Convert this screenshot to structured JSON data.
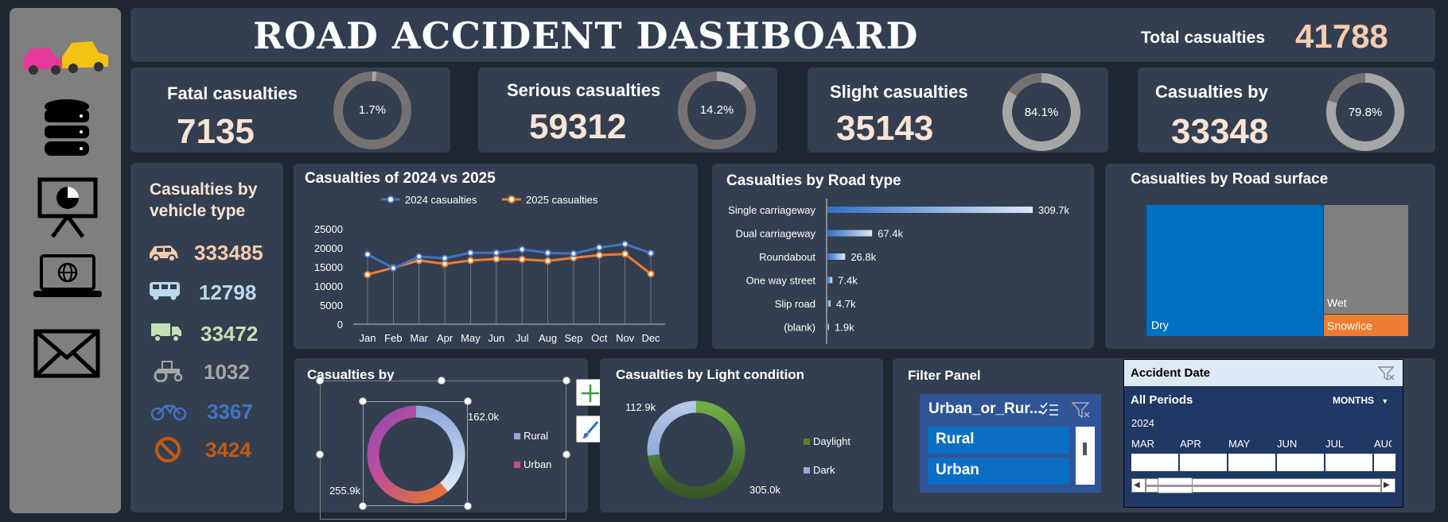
{
  "header": {
    "title": "ROAD ACCIDENT DASHBOARD",
    "total_label": "Total casualties",
    "total_value": "41788"
  },
  "kpis": [
    {
      "label": "Fatal casualties",
      "value": "7135",
      "pct": "1.7%",
      "fraction": 0.017
    },
    {
      "label": "Serious casualties",
      "value": "59312",
      "pct": "14.2%",
      "fraction": 0.142
    },
    {
      "label": "Slight casualties",
      "value": "35143",
      "pct": "84.1%",
      "fraction": 0.841
    },
    {
      "label": "Casualties by",
      "value": "33348",
      "pct": "79.8%",
      "fraction": 0.798
    }
  ],
  "vehicle": {
    "title_line1": "Casualties by",
    "title_line2": "vehicle type",
    "items": [
      {
        "icon": "car-icon",
        "value": "333485",
        "color": "#f8cbad"
      },
      {
        "icon": "bus-icon",
        "value": "12798",
        "color": "#bdd7ee"
      },
      {
        "icon": "truck-icon",
        "value": "33472",
        "color": "#c5e0b4"
      },
      {
        "icon": "tractor-icon",
        "value": "1032",
        "color": "#a6a6a6"
      },
      {
        "icon": "motorcycle-icon",
        "value": "3367",
        "color": "#4472c4"
      },
      {
        "icon": "no-entry-icon",
        "value": "3424",
        "color": "#c55a11"
      }
    ]
  },
  "charts": {
    "line": {
      "title": "Casualties of 2024 vs 2025",
      "chart_data": {
        "type": "line",
        "x": [
          "Jan",
          "Feb",
          "Mar",
          "Apr",
          "May",
          "Jun",
          "Jul",
          "Aug",
          "Sep",
          "Oct",
          "Nov",
          "Dec"
        ],
        "series": [
          {
            "name": "2024 casualties",
            "color": "#4472c4",
            "values": [
              18300,
              14700,
              17700,
              17300,
              18700,
              18700,
              19600,
              18700,
              18500,
              20100,
              21000,
              18600
            ]
          },
          {
            "name": "2025 casualties",
            "color": "#ed7d31",
            "values": [
              13000,
              14800,
              16700,
              15800,
              16700,
              17100,
              17000,
              16600,
              17400,
              18100,
              18400,
              13200
            ]
          }
        ],
        "ylim": [
          0,
          25000
        ],
        "yticks": [
          "25000",
          "20000",
          "15000",
          "10000",
          "5000",
          "0"
        ]
      }
    },
    "road": {
      "title": "Casualties by Road type",
      "chart_data": {
        "type": "bar",
        "categories": [
          "Single carriageway",
          "Dual carriageway",
          "Roundabout",
          "One way street",
          "Slip road",
          "(blank)"
        ],
        "values": [
          309700,
          67400,
          26800,
          7400,
          4700,
          1900
        ],
        "labels": [
          "309.7k",
          "67.4k",
          "26.8k",
          "7.4k",
          "4.7k",
          "1.9k"
        ]
      }
    },
    "surface": {
      "title": "Casualties by Road surface",
      "labels": [
        "Dry",
        "Wet",
        "Snow/ice"
      ]
    },
    "area": {
      "title": "Casualties by",
      "chart_data": {
        "type": "pie",
        "categories": [
          "Rural",
          "Urban"
        ],
        "values": [
          162000,
          255900
        ],
        "labels": [
          "162.0k",
          "255.9k"
        ]
      }
    },
    "light": {
      "title": "Casualties by Light condition",
      "chart_data": {
        "type": "pie",
        "categories": [
          "Daylight",
          "Dark"
        ],
        "values": [
          305000,
          112900
        ],
        "labels": [
          "305.0k",
          "112.9k"
        ]
      }
    }
  },
  "filter": {
    "title": "Filter Panel",
    "slicer_title": "Urban_or_Rur...",
    "options": [
      "Rural",
      "Urban"
    ]
  },
  "timeline": {
    "title": "Accident Date",
    "period": "All Periods",
    "unit": "MONTHS",
    "year": "2024",
    "months": [
      "MAR",
      "APR",
      "MAY",
      "JUN",
      "JUL",
      "AUG"
    ]
  }
}
